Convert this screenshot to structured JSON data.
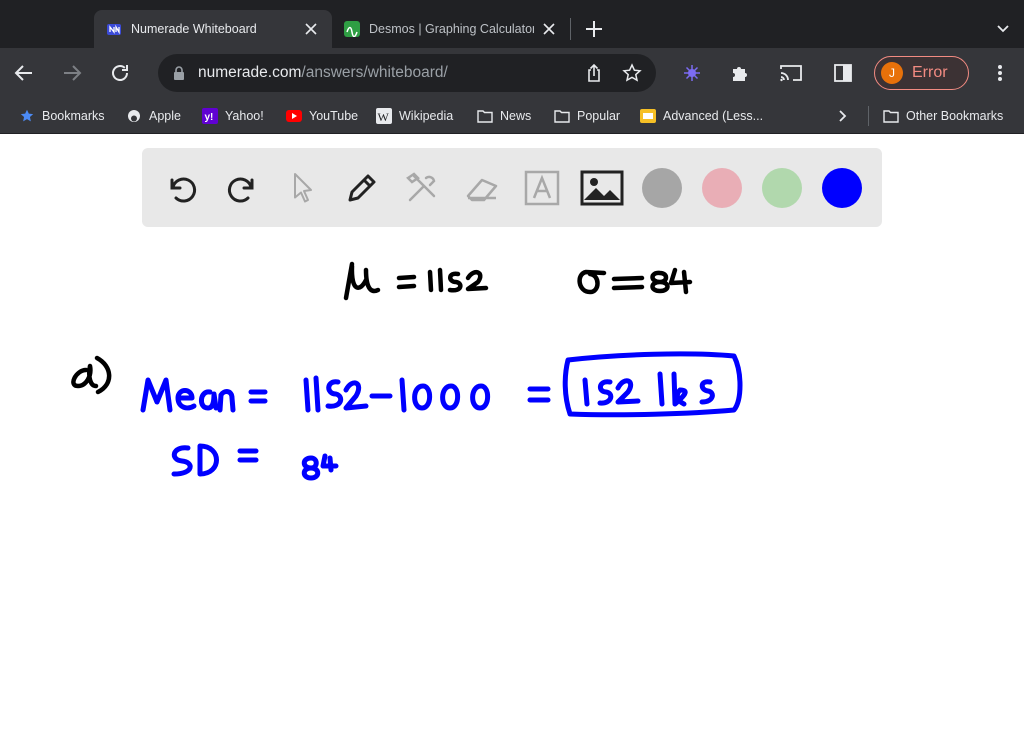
{
  "browser": {
    "tabs": [
      {
        "title": "Numerade Whiteboard",
        "active": true,
        "favicon": "numerade-icon"
      },
      {
        "title": "Desmos | Graphing Calculator",
        "active": false,
        "favicon": "desmos-icon"
      }
    ],
    "url": {
      "domain": "numerade.com",
      "path": "/answers/whiteboard/"
    },
    "profile": {
      "initial": "J",
      "status": "Error"
    },
    "bookmarks": [
      {
        "label": "Bookmarks",
        "icon": "star-icon"
      },
      {
        "label": "Apple",
        "icon": "apple-icon"
      },
      {
        "label": "Yahoo!",
        "icon": "yahoo-icon"
      },
      {
        "label": "YouTube",
        "icon": "youtube-icon"
      },
      {
        "label": "Wikipedia",
        "icon": "wikipedia-icon"
      },
      {
        "label": "News",
        "icon": "folder-icon"
      },
      {
        "label": "Popular",
        "icon": "folder-icon"
      },
      {
        "label": "Advanced (Less...",
        "icon": "bookmark-page-icon"
      }
    ],
    "other_bookmarks": "Other Bookmarks"
  },
  "whiteboard": {
    "tools": [
      "undo-icon",
      "redo-icon",
      "pointer-icon",
      "pen-icon",
      "tools-icon",
      "eraser-icon",
      "text-icon",
      "image-icon"
    ],
    "colors": [
      {
        "name": "gray",
        "hex": "#a6a6a6"
      },
      {
        "name": "pink",
        "hex": "#e9aeb6"
      },
      {
        "name": "green",
        "hex": "#b1d8ad"
      },
      {
        "name": "blue",
        "hex": "#0000ff",
        "selected": true
      }
    ]
  },
  "handwriting": {
    "line1_mu": "μ = 1152",
    "line1_sigma": "σ = 84",
    "part_label": "a)",
    "mean_line": "Mean = 1152 − 1000 =",
    "mean_result": "152 lbs",
    "sd_line": "SD = 84"
  },
  "colors": {
    "ink_black": "#000000",
    "ink_blue": "#0000ff",
    "chrome_dark": "#202124",
    "chrome": "#35363a"
  }
}
